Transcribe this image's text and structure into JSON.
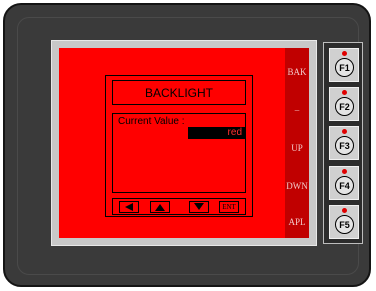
{
  "screen": {
    "dialog": {
      "title": "BACKLIGHT",
      "label": "Current Value :",
      "value": "red",
      "nav": {
        "left": "left-arrow-icon",
        "up": "up-arrow-icon",
        "down": "down-arrow-icon",
        "enter_label": "ENT"
      }
    },
    "softkeys": [
      "BAK",
      "–",
      "UP",
      "DWN",
      "APL"
    ]
  },
  "function_keys": [
    "F1",
    "F2",
    "F3",
    "F4",
    "F5"
  ],
  "colors": {
    "screen_background": "#ff0000",
    "softkey_column": "#c00000",
    "bezel": "#3a3a3a",
    "value_background": "#000000",
    "value_text": "#ff3030",
    "key_led": "#e00000"
  }
}
